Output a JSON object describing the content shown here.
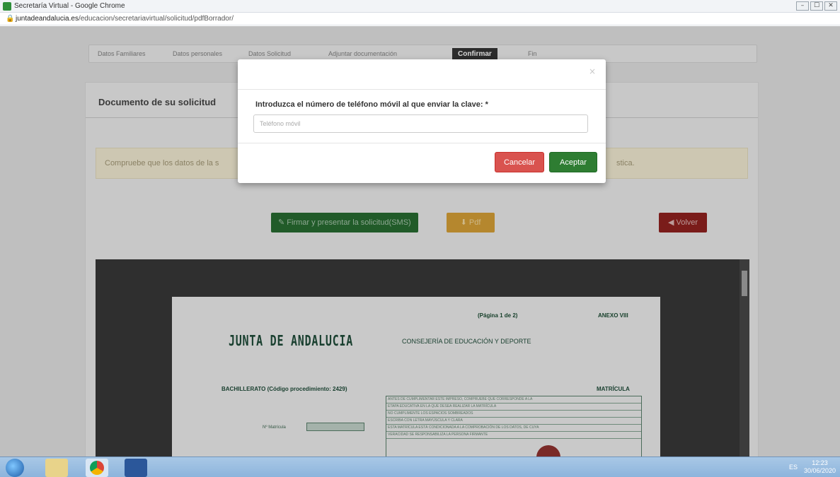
{
  "window": {
    "title": "Secretaría Virtual - Google Chrome",
    "minimize": "–",
    "maximize": "☐",
    "close": "✕"
  },
  "addressbar": {
    "url_domain": "juntadeandalucia.es",
    "url_path": "/educacion/secretariavirtual/solicitud/pdfBorrador/"
  },
  "steps": {
    "items": [
      "Datos Familiares",
      "Datos personales",
      "Datos Solicitud",
      "Adjuntar documentación"
    ],
    "active": "Confirmar",
    "next": "Fin"
  },
  "card": {
    "title": "Documento de su solicitud"
  },
  "notice": {
    "text_left": "Compruebe que los datos de la s",
    "text_right": "stica."
  },
  "actions": {
    "sign_label": "Firmar y presentar la solicitud(SMS)",
    "pdf_label": "Pdf",
    "back_label": "Volver"
  },
  "pdf": {
    "page_label": "(Página 1 de 2)",
    "anexo_label": "ANEXO VIII",
    "org": "JUNTA DE ANDALUCIA",
    "consejeria": "CONSEJERÍA DE EDUCACIÓN Y DEPORTE",
    "bachillerato": "BACHILLERATO (Código procedimiento: 2429)",
    "matricula": "MATRÍCULA",
    "info_lines": [
      "ANTES DE CUMPLIMENTAR ESTE IMPRESO, COMPRUEBE QUE CORRESPONDE A LA",
      "ETAPA EDUCATIVA EN LA QUE DESEA REALIZAR LA MATRÍCULA",
      "NO CUMPLIMENTE LOS ESPACIOS SOMBREADOS",
      "ESCRIBA CON LETRA MAYÚSCULA Y CLARA",
      "ESTA MATRÍCULA ESTÁ CONDICIONADA A LA COMPROBACIÓN DE LOS DATOS, DE CUYA",
      "VERACIDAD SE RESPONSABILIZA LA PERSONA FIRMANTE"
    ],
    "n_matricula": "Nº Matrícula"
  },
  "modal": {
    "close": "×",
    "prompt": "Introduzca el número de teléfono móvil al que enviar la clave: *",
    "phone_placeholder": "Teléfono móvil",
    "phone_value": "",
    "cancel_label": "Cancelar",
    "accept_label": "Aceptar"
  },
  "taskbar": {
    "tray": "ES",
    "time": "12:23",
    "date": "30/06/2020"
  }
}
